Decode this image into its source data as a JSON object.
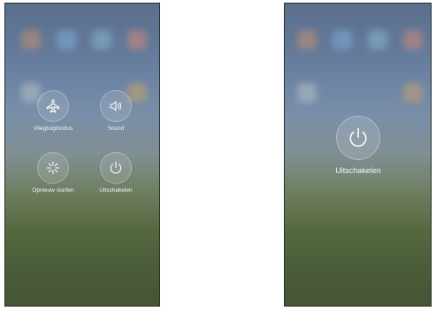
{
  "left_screen": {
    "buttons": [
      {
        "label": "Vliegtuigmodus",
        "icon": "airplane-icon"
      },
      {
        "label": "Sound",
        "icon": "speaker-icon"
      },
      {
        "label": "Opnieuw starten",
        "icon": "restart-icon"
      },
      {
        "label": "Uitschakelen",
        "icon": "power-icon"
      }
    ]
  },
  "right_screen": {
    "button": {
      "label": "Uitschakelen",
      "icon": "power-icon"
    }
  }
}
